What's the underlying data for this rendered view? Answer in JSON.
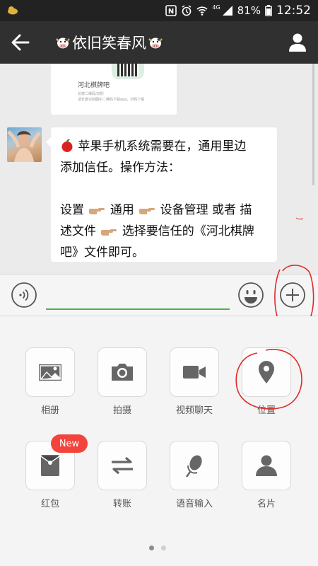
{
  "status_bar": {
    "battery": "81%",
    "time": "12:52",
    "network": "4G",
    "icons": [
      "weather-icon",
      "nfc-icon",
      "alarm-icon",
      "wifi-icon",
      "signal-icon",
      "battery-icon"
    ]
  },
  "header": {
    "title": "依旧笑春风",
    "back_icon": "back-arrow-icon",
    "profile_icon": "profile-icon"
  },
  "chat": {
    "shared_card": {
      "title": "河北棋牌吧",
      "line1": "长按二维码/识别",
      "line2": "请长按识别图中二维码下载app，扫码下载"
    },
    "message": {
      "lines": [
        "苹果手机系统需要在，通用里边",
        "添加信任。操作方法：",
        "",
        "设置",
        "通用",
        "设备管理  或者  描",
        "述文件",
        "选择要信任的《河北棋牌",
        "吧》文件即可。"
      ]
    }
  },
  "input_bar": {
    "value": "",
    "placeholder": ""
  },
  "panel": {
    "items": [
      {
        "label": "相册",
        "icon": "photo-album-icon"
      },
      {
        "label": "拍摄",
        "icon": "camera-icon"
      },
      {
        "label": "视频聊天",
        "icon": "video-call-icon"
      },
      {
        "label": "位置",
        "icon": "location-icon"
      },
      {
        "label": "红包",
        "icon": "red-packet-icon"
      },
      {
        "label": "转账",
        "icon": "transfer-icon"
      },
      {
        "label": "语音输入",
        "icon": "microphone-icon"
      },
      {
        "label": "名片",
        "icon": "contact-card-icon"
      }
    ],
    "new_badge": "New",
    "page": 1,
    "page_count": 2
  },
  "colors": {
    "header_bg": "#303030",
    "accent_green": "#4cb045",
    "badge_red": "#f2443d",
    "annotation_red": "#e02a2a"
  }
}
